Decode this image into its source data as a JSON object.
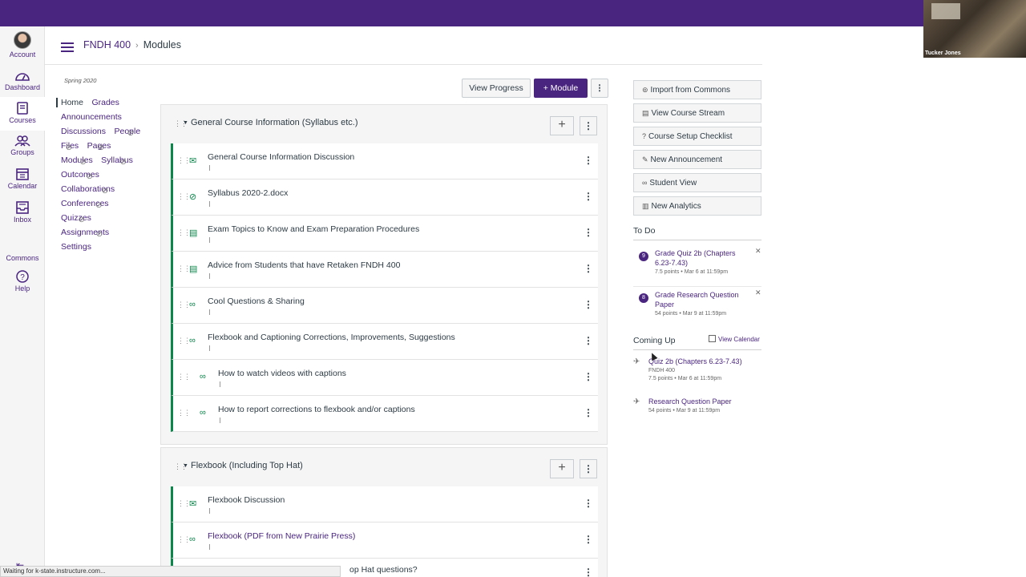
{
  "video": {
    "participant": "Tucker Jones"
  },
  "global_nav": [
    {
      "label": "Account",
      "icon": "avatar-icon"
    },
    {
      "label": "Dashboard",
      "icon": "dashboard-icon"
    },
    {
      "label": "Courses",
      "icon": "courses-icon",
      "active": true
    },
    {
      "label": "Groups",
      "icon": "groups-icon"
    },
    {
      "label": "Calendar",
      "icon": "calendar-icon"
    },
    {
      "label": "Inbox",
      "icon": "inbox-icon"
    },
    {
      "label": "Commons",
      "icon": "commons-icon"
    },
    {
      "label": "Help",
      "icon": "help-icon"
    }
  ],
  "breadcrumb": {
    "course": "FNDH 400",
    "page": "Modules"
  },
  "course_nav": {
    "term": "Spring 2020",
    "items": [
      {
        "label": "Home",
        "active": true,
        "hidden": false
      },
      {
        "label": "Grades",
        "hidden": false
      },
      {
        "label": "Announcements",
        "hidden": false
      },
      {
        "label": "Discussions",
        "hidden": false
      },
      {
        "label": "People",
        "hidden": true
      },
      {
        "label": "Files",
        "hidden": true
      },
      {
        "label": "Pages",
        "hidden": true
      },
      {
        "label": "Modules",
        "hidden": true
      },
      {
        "label": "Syllabus",
        "hidden": true
      },
      {
        "label": "Outcomes",
        "hidden": true
      },
      {
        "label": "Collaborations",
        "hidden": true
      },
      {
        "label": "Conferences",
        "hidden": true
      },
      {
        "label": "Quizzes",
        "hidden": true
      },
      {
        "label": "Assignments",
        "hidden": true
      },
      {
        "label": "Settings",
        "hidden": false
      }
    ]
  },
  "toolbar": {
    "view_progress": "View Progress",
    "add_module": "Module",
    "plus": "+",
    "kebab": "⋮"
  },
  "modules": [
    {
      "title": "General Course Information (Syllabus etc.)",
      "items": [
        {
          "title": "General Course Information Discussion",
          "type": "discussion"
        },
        {
          "title": "Syllabus 2020-2.docx",
          "type": "attachment"
        },
        {
          "title": "Exam Topics to Know and Exam Preparation Procedures",
          "type": "page"
        },
        {
          "title": "Advice from Students that have Retaken FNDH 400",
          "type": "page"
        },
        {
          "title": "Cool Questions & Sharing",
          "type": "link"
        },
        {
          "title": "Flexbook and Captioning Corrections, Improvements, Suggestions",
          "type": "link"
        },
        {
          "title": "How to watch videos with captions",
          "type": "link",
          "indent": true
        },
        {
          "title": "How to report corrections to flexbook and/or captions",
          "type": "link",
          "indent": true
        }
      ]
    },
    {
      "title": "Flexbook (Including Top Hat)",
      "items": [
        {
          "title": "Flexbook Discussion",
          "type": "discussion"
        },
        {
          "title": "Flexbook (PDF from New Prairie Press)",
          "type": "link",
          "is_link": true
        },
        {
          "title": "op Hat questions?",
          "type": "page"
        }
      ]
    }
  ],
  "sidebar": {
    "buttons": [
      {
        "label": "Import from Commons",
        "icon": "commons-icon",
        "glyph": "⊚"
      },
      {
        "label": "View Course Stream",
        "icon": "stream-icon",
        "glyph": "▤"
      },
      {
        "label": "Course Setup Checklist",
        "icon": "question-circle-icon",
        "glyph": "?"
      },
      {
        "label": "New Announcement",
        "icon": "megaphone-icon",
        "glyph": "✎"
      },
      {
        "label": "Student View",
        "icon": "glasses-icon",
        "glyph": "∞"
      },
      {
        "label": "New Analytics",
        "icon": "analytics-icon",
        "glyph": "▥"
      }
    ],
    "todo_heading": "To Do",
    "todo": [
      {
        "badge": "9",
        "title": "Grade Quiz 2b (Chapters 6.23-7.43)",
        "meta": "7.5 points • Mar 6 at 11:59pm"
      },
      {
        "badge": "8",
        "title": "Grade Research Question Paper",
        "meta": "54 points • Mar 9 at 11:59pm"
      }
    ],
    "coming_up_heading": "Coming Up",
    "view_calendar": "View Calendar",
    "coming_up": [
      {
        "title": "Quiz 2b (Chapters 6.23-7.43)",
        "course": "FNDH 400",
        "meta": "7.5 points • Mar 6 at 11:59pm"
      },
      {
        "title": "Research Question Paper",
        "course": "",
        "meta": "54 points • Mar 9 at 11:59pm"
      }
    ]
  },
  "status_bar": "Waiting for k-state.instructure.com...",
  "colors": {
    "brand": "#4a2580",
    "published": "#0b874b"
  }
}
